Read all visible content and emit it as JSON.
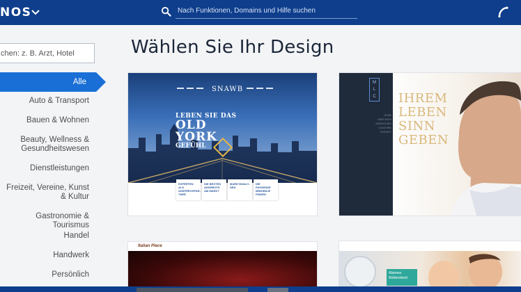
{
  "header": {
    "brand": "NOS",
    "search_placeholder": "Nach Funktionen, Domains und Hilfe suchen"
  },
  "sidebar": {
    "filter_placeholder": "chen: z. B. Arzt, Hotel",
    "categories": [
      "Alle",
      "Auto & Transport",
      "Bauen & Wohnen",
      "Beauty, Wellness & Gesundheitswesen",
      "Dienstleistungen",
      "Freizeit, Vereine, Kunst & Kultur",
      "Gastronomie & Tourismus",
      "Handel",
      "Handwerk",
      "Persönlich"
    ]
  },
  "main": {
    "title": "Wählen Sie Ihr Design",
    "templates": [
      {
        "logo": "SNAWB",
        "headline_small": "LEBEN SIE DAS",
        "headline_big": "OLD YORK",
        "headline_sub": "GEFÜHL",
        "boxes": [
          "EXPERTEN ALS ANSPRECHPAR­TNER",
          "DIE BESTEN ANGEBOTE AM MARKT",
          "MARKTANALY­SEN",
          "DIE PASSENDE IMMOBILIE FINDEN"
        ]
      },
      {
        "logo": "MLC",
        "menu": [
          "HOME",
          "ÜBER MICH",
          "AUSBILDUNG",
          "COACHING",
          "KONTAKT"
        ],
        "quote": "IHREM LEBEN SINN GEBEN"
      },
      {
        "brand": "Italian Place"
      },
      {
        "badge": "Warmes Wolkenkleid"
      }
    ]
  },
  "colors": {
    "header": "#0e3e8c",
    "active_category": "#1a6fd6",
    "title": "#1b2638"
  }
}
